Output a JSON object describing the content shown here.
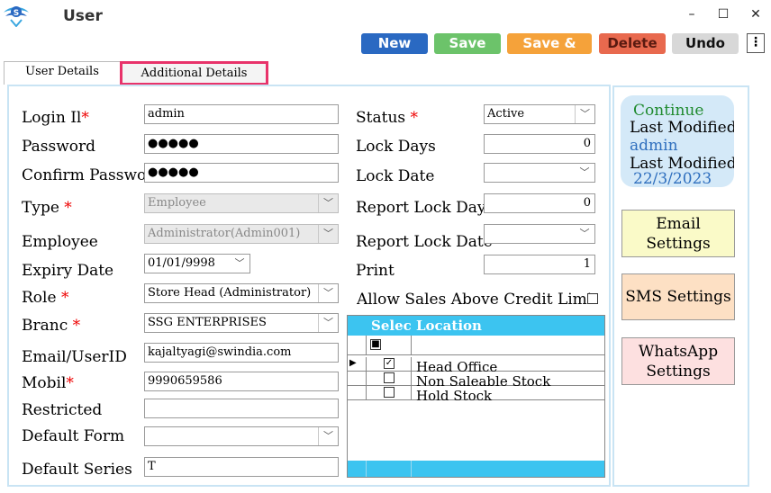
{
  "window": {
    "title": "User",
    "minimize": "–",
    "maximize": "☐",
    "close": "✕"
  },
  "toolbar": {
    "new": "New",
    "save": "Save",
    "save_and": "Save &",
    "delete": "Delete",
    "undo": "Undo",
    "more": "⋮",
    "colors": {
      "new": "#2a69c2",
      "save": "#6cc36a",
      "save_and": "#f5a23a",
      "delete": "#e8694e",
      "undo": "#d8d8d8"
    }
  },
  "tabs": {
    "user_details": "User Details",
    "additional_details": "Additional Details"
  },
  "form": {
    "login_id": {
      "label": "Login Il",
      "value": "admin"
    },
    "password": {
      "label": "Password",
      "value": "●●●●●"
    },
    "confirm_password": {
      "label": "Confirm Passwoi",
      "value": "●●●●●"
    },
    "type": {
      "label": "Type",
      "value": "Employee"
    },
    "employee": {
      "label": "Employee",
      "value": "Administrator(Admin001)"
    },
    "expiry_date": {
      "label": "Expiry Date",
      "value": "01/01/9998"
    },
    "role": {
      "label": "Role",
      "value": "Store Head (Administrator)"
    },
    "branch": {
      "label": "Branc",
      "value": "SSG ENTERPRISES"
    },
    "email": {
      "label": "Email/UserID",
      "value": "kajaltyagi@swindia.com"
    },
    "mobile": {
      "label": "Mobil",
      "value": "9990659586"
    },
    "restricted": {
      "label": "Restricted",
      "value": ""
    },
    "default_form": {
      "label": "Default Form",
      "value": ""
    },
    "default_series": {
      "label": "Default Series",
      "value": "T"
    },
    "status": {
      "label": "Status",
      "value": "Active"
    },
    "lock_days": {
      "label": "Lock Days",
      "value": "0"
    },
    "lock_date": {
      "label": "Lock Date",
      "value": ""
    },
    "report_lock_days": {
      "label": "Report Lock Days",
      "value": "0"
    },
    "report_lock_date": {
      "label": "Report Lock Date",
      "value": ""
    },
    "print": {
      "label": "Print",
      "value": "1"
    },
    "allow_sales": {
      "label": "Allow Sales Above Credit Limit"
    },
    "required_mark": "*"
  },
  "location_grid": {
    "headers": [
      "Selec",
      "Location"
    ],
    "select_all": "■",
    "rows": [
      {
        "checked": "✓",
        "location": "Head Office"
      },
      {
        "checked": "",
        "location": "Non Saleable Stock"
      },
      {
        "checked": "",
        "location": "Hold Stock"
      }
    ],
    "current_marker": "▶"
  },
  "side": {
    "continue": "Continue",
    "last_modified_by": "Last Modified I",
    "last_modified_user": "admin",
    "last_modified_on": "Last Modified I",
    "last_modified_date": "22/3/2023",
    "email_settings": "Email Settings",
    "sms_settings": "SMS Settings",
    "whatsapp_settings": "WhatsApp Settings",
    "colors": {
      "email": "#fafac8",
      "sms": "#fde0c4",
      "whatsapp": "#fde0e0",
      "continue": "#1f8a2e",
      "value": "#2f6fbe"
    }
  },
  "icons": {
    "dropdown": "chevron-down-icon",
    "logo": "app-logo-icon"
  }
}
